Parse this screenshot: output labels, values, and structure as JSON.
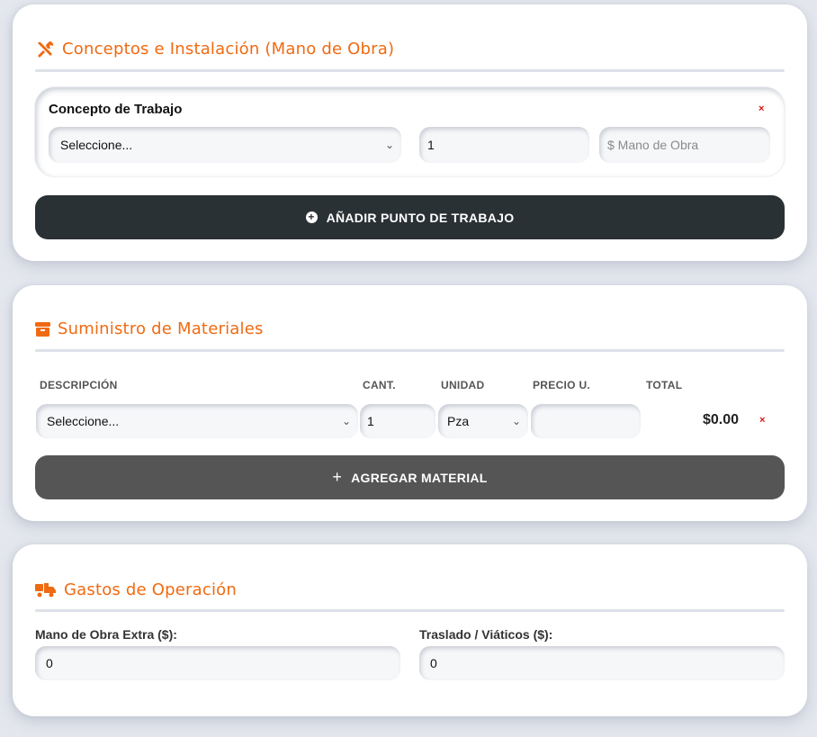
{
  "labor": {
    "title": "Conceptos e Instalación (Mano de Obra)",
    "concept_label": "Concepto de Trabajo",
    "remove_symbol": "×",
    "select_value": "Seleccione...",
    "quantity": "1",
    "price_placeholder": "$ Mano de Obra",
    "add_button": "AÑADIR PUNTO DE TRABAJO"
  },
  "materials": {
    "title": "Suministro de Materiales",
    "columns": [
      "DESCRIPCIÓN",
      "CANT.",
      "UNIDAD",
      "PRECIO U.",
      "TOTAL"
    ],
    "row": {
      "description": "Seleccione...",
      "quantity": "1",
      "unit": "Pza",
      "unit_price": "",
      "total": "$0.00",
      "remove_symbol": "×"
    },
    "add_button": "AGREGAR MATERIAL"
  },
  "operations": {
    "title": "Gastos de Operación",
    "extra_labor_label": "Mano de Obra Extra ($):",
    "extra_labor_value": "0",
    "travel_label": "Traslado / Viáticos ($):",
    "travel_value": "0"
  },
  "colors": {
    "accent": "#f06a12",
    "dark_button": "#2a3134",
    "gray_button": "#555555",
    "remove": "#dd1111"
  }
}
